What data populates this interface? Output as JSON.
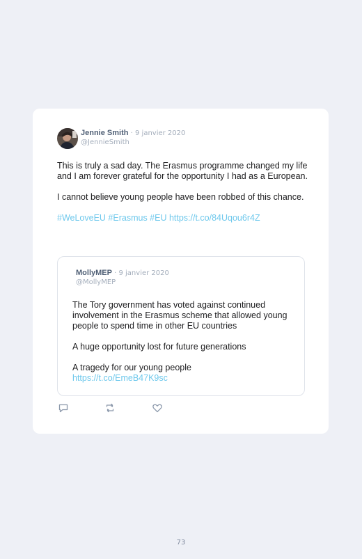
{
  "tweet": {
    "author_name": "Jennie Smith",
    "date": " · 9 janvier 2020",
    "handle": "@JennieSmith",
    "paragraphs": [
      "This is truly a sad day. The Erasmus programme changed my life and I am forever grateful for the opportunity I had as a European.",
      "I cannot believe young people have been robbed of this chance."
    ],
    "hashtags": "#WeLoveEU #Erasmus #EU https://t.co/84Uqou6r4Z"
  },
  "quoted": {
    "author_name": "MollyMEP",
    "date": " · 9 janvier 2020",
    "handle": "@MollyMEP",
    "paragraphs": [
      "The Tory government has voted against continued involvement in the Erasmus scheme that allowed young people to spend time in other EU countries",
      "A huge opportunity lost for future generations"
    ],
    "last_line": "A tragedy for our young people",
    "link": "https://t.co/EmeB47K9sc"
  },
  "actions": {
    "reply_icon": "reply-icon",
    "retweet_icon": "retweet-icon",
    "like_icon": "like-icon"
  },
  "page_number": "73",
  "colors": {
    "background": "#eef0f6",
    "card": "#ffffff",
    "link": "#6ec8ec",
    "name": "#4f5f75",
    "muted": "#a3adbb"
  }
}
